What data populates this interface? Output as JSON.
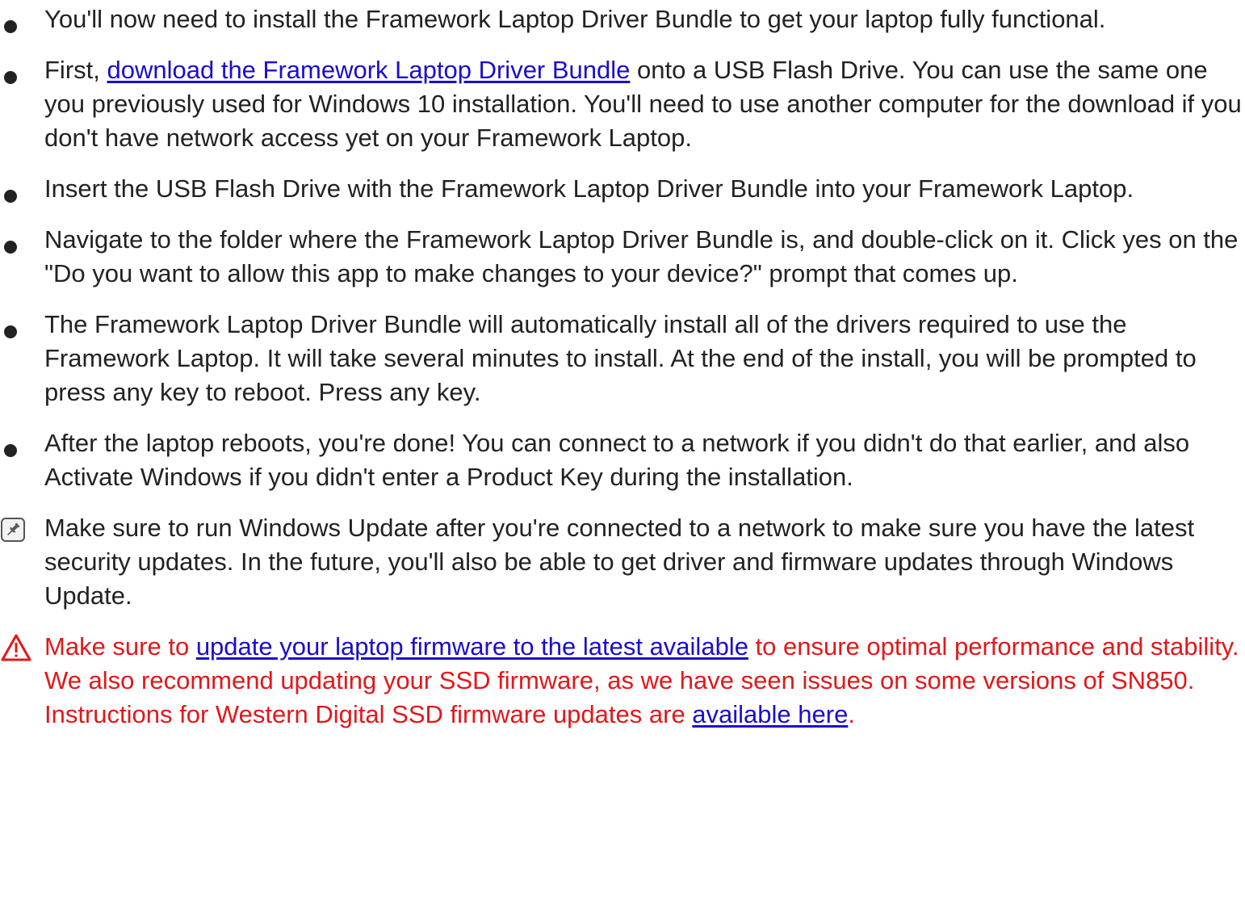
{
  "steps": [
    {
      "text": "You'll now need to install the Framework Laptop Driver Bundle to get your laptop fully functional."
    },
    {
      "before": "First, ",
      "link": "download the Framework Laptop Driver Bundle",
      "after": " onto a USB Flash Drive. You can use the same one you previously used for Windows 10 installation. You'll need to use another computer for the download if you don't have network access yet on your Framework Laptop."
    },
    {
      "text": "Insert the USB Flash Drive with the Framework Laptop Driver Bundle into your Framework Laptop."
    },
    {
      "text": "Navigate to the folder where the Framework Laptop Driver Bundle is, and double-click on it. Click yes on the \"Do you want to allow this app to make changes to your device?\" prompt that comes up."
    },
    {
      "text": "The Framework Laptop Driver Bundle will automatically install all of the drivers required to use the Framework Laptop. It will take several minutes to install. At the end of the install, you will be prompted to press any key to reboot. Press any key."
    },
    {
      "text": "After the laptop reboots, you're done! You can connect to a network if you didn't do that earlier, and also Activate Windows if you didn't enter a Product Key during the installation."
    }
  ],
  "note": {
    "icon": "pin-icon",
    "text": "Make sure to run Windows Update after you're connected to a network to make sure you have the latest security updates. In the future, you'll also be able to get driver and firmware updates through Windows Update."
  },
  "warning": {
    "icon": "warning-triangle-icon",
    "before": "Make sure to ",
    "link1": "update your laptop firmware to the latest available",
    "middle": " to ensure optimal performance and stability. We also recommend updating your SSD firmware, as we have seen issues on some versions of SN850. Instructions for Western Digital SSD firmware updates are ",
    "link2": "available here",
    "after": "."
  },
  "colors": {
    "text": "#222222",
    "link": "#1a0dce",
    "warning": "#e3171a"
  }
}
